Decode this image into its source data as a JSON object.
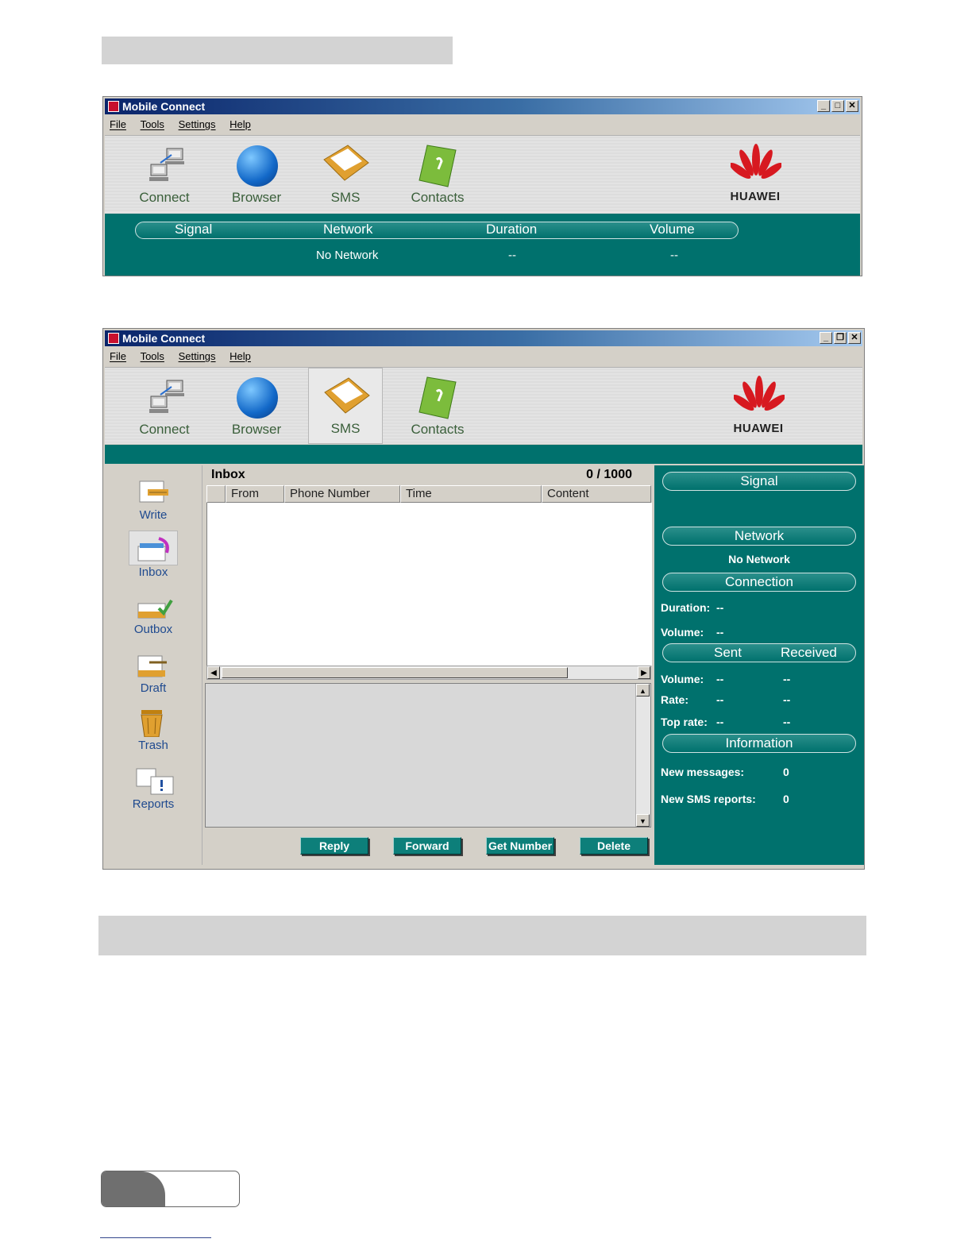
{
  "window_top": {
    "title": "Mobile Connect",
    "menu": [
      "File",
      "Tools",
      "Settings",
      "Help"
    ],
    "toolbar": [
      "Connect",
      "Browser",
      "SMS",
      "Contacts"
    ],
    "brand": "HUAWEI",
    "status_headers": [
      "Signal",
      "Network",
      "Duration",
      "Volume"
    ],
    "status_values": {
      "network": "No Network",
      "duration": "--",
      "volume": "--"
    }
  },
  "window_sms": {
    "title": "Mobile Connect",
    "menu": [
      "File",
      "Tools",
      "Settings",
      "Help"
    ],
    "toolbar": [
      "Connect",
      "Browser",
      "SMS",
      "Contacts"
    ],
    "active_tool": "SMS",
    "brand": "HUAWEI",
    "sidebar": [
      "Write",
      "Inbox",
      "Outbox",
      "Draft",
      "Trash",
      "Reports"
    ],
    "active_folder": "Inbox",
    "folder_title": "Inbox",
    "count": "0 / 1000",
    "columns": [
      "From",
      "Phone Number",
      "Time",
      "Content"
    ],
    "buttons": [
      "Reply",
      "Forward",
      "Get Number",
      "Delete"
    ],
    "panel": {
      "signal": "Signal",
      "network": "Network",
      "network_value": "No Network",
      "connection": "Connection",
      "duration_label": "Duration:",
      "duration_value": "--",
      "volume_label": "Volume:",
      "volume_value": "--",
      "sent": "Sent",
      "received": "Received",
      "rows": [
        {
          "label": "Volume:",
          "sent": "--",
          "received": "--"
        },
        {
          "label": "Rate:",
          "sent": "--",
          "received": "--"
        },
        {
          "label": "Top rate:",
          "sent": "--",
          "received": "--"
        }
      ],
      "information": "Information",
      "new_messages_label": "New messages:",
      "new_messages_value": "0",
      "new_reports_label": "New SMS reports:",
      "new_reports_value": "0"
    }
  },
  "colors": {
    "teal": "#00716d",
    "title_start": "#0a246a",
    "title_end": "#a6caf0"
  },
  "icons": [
    "connect-icon",
    "browser-globe-icon",
    "sms-envelope-icon",
    "contacts-book-icon",
    "huawei-logo",
    "write-icon",
    "inbox-icon",
    "outbox-icon",
    "draft-icon",
    "trash-icon",
    "reports-icon"
  ]
}
